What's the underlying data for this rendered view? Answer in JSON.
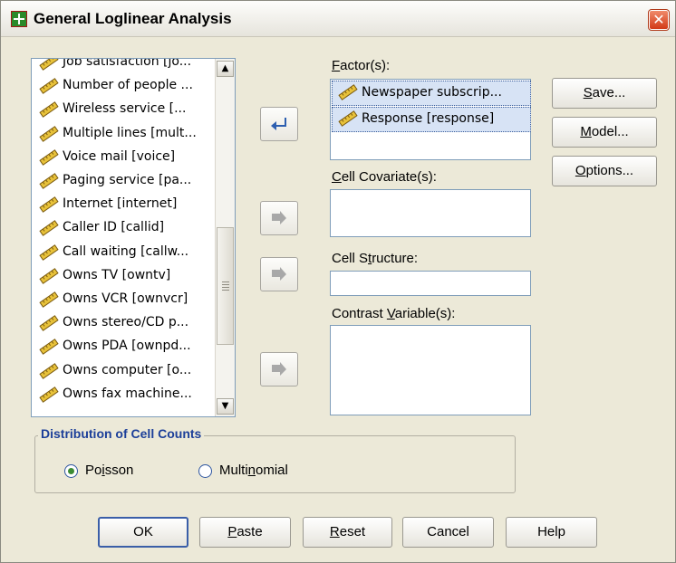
{
  "window": {
    "title": "General Loglinear Analysis",
    "close_glyph": "✕"
  },
  "source_list": {
    "items": [
      {
        "label": "Job satisfaction [jo...",
        "icon": "ruler-pencil-icon"
      },
      {
        "label": "Number of people ...",
        "icon": "ruler-pencil-icon"
      },
      {
        "label": "Wireless service [...",
        "icon": "ruler-pencil-icon"
      },
      {
        "label": "Multiple lines [mult...",
        "icon": "ruler-pencil-icon"
      },
      {
        "label": "Voice mail [voice]",
        "icon": "ruler-pencil-icon"
      },
      {
        "label": "Paging service [pa...",
        "icon": "ruler-pencil-icon"
      },
      {
        "label": "Internet [internet]",
        "icon": "ruler-pencil-icon"
      },
      {
        "label": "Caller ID [callid]",
        "icon": "ruler-pencil-icon"
      },
      {
        "label": "Call waiting [callw...",
        "icon": "ruler-pencil-icon"
      },
      {
        "label": "Owns TV [owntv]",
        "icon": "ruler-pencil-icon"
      },
      {
        "label": "Owns VCR [ownvcr]",
        "icon": "ruler-pencil-icon"
      },
      {
        "label": "Owns stereo/CD p...",
        "icon": "ruler-pencil-icon"
      },
      {
        "label": "Owns PDA [ownpd...",
        "icon": "ruler-pencil-icon"
      },
      {
        "label": "Owns computer [o...",
        "icon": "ruler-pencil-icon"
      },
      {
        "label": "Owns fax machine...",
        "icon": "ruler-pencil-icon"
      }
    ],
    "scroll_up_glyph": "▲",
    "scroll_down_glyph": "▼"
  },
  "factors": {
    "label_prefix": "",
    "label_mnemonic": "F",
    "label_rest": "actor(s):",
    "items": [
      {
        "label": "Newspaper subscrip...",
        "icon": "ruler-pencil-icon"
      },
      {
        "label": "Response [response]",
        "icon": "ruler-pencil-icon"
      }
    ]
  },
  "cell_covariates": {
    "label_mnemonic": "C",
    "label_rest": "ell Covariate(s):"
  },
  "cell_structure": {
    "label_before": "Cell S",
    "label_mnemonic": "t",
    "label_after": "ructure:",
    "value": ""
  },
  "contrast_variables": {
    "label_before": "Contrast ",
    "label_mnemonic": "V",
    "label_after": "ariable(s):"
  },
  "side_buttons": {
    "save": {
      "mnemonic": "S",
      "rest": "ave..."
    },
    "model": {
      "mnemonic": "M",
      "rest": "odel..."
    },
    "options": {
      "mnemonic": "O",
      "rest": "ptions..."
    }
  },
  "distribution": {
    "title": "Distribution of Cell Counts",
    "poisson": {
      "before": "Po",
      "mnemonic": "i",
      "after": "sson",
      "checked": true
    },
    "multinomial": {
      "before": "Multi",
      "mnemonic": "n",
      "after": "omial",
      "checked": false
    }
  },
  "bottom_buttons": {
    "ok": "OK",
    "paste": {
      "mnemonic": "P",
      "rest": "aste"
    },
    "reset": {
      "mnemonic": "R",
      "rest": "eset"
    },
    "cancel": "Cancel",
    "help": "Help"
  },
  "colors": {
    "dialog_bg": "#ece9d8",
    "group_title": "#1c3f99",
    "selection_bg": "#d7e3f5",
    "move_arrow_active": "#2d5fb0",
    "move_arrow_disabled": "#a8a8a8"
  },
  "icons": {
    "move_factor": "arrow-left-icon",
    "move_covariate": "arrow-right-icon",
    "move_structure": "arrow-right-icon",
    "move_contrast": "arrow-right-icon"
  }
}
